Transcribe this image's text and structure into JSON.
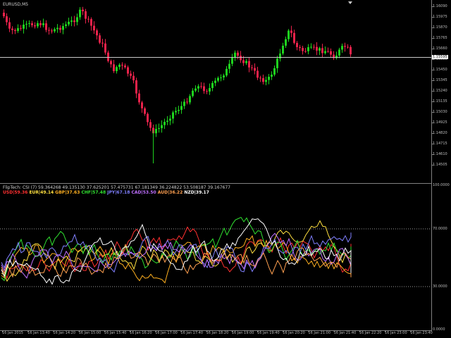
{
  "main_chart": {
    "title": "EURUSD,M5",
    "current_price": "1.15595",
    "price_labels": [
      "1.16090",
      "1.15975",
      "1.15870",
      "1.15765",
      "1.15660",
      "1.15555",
      "1.15450",
      "1.15345",
      "1.15240",
      "1.15135",
      "1.15030",
      "1.14925",
      "1.14820",
      "1.14715",
      "1.14610",
      "1.14505"
    ],
    "colors": {
      "bull": "#1ed21e",
      "bear": "#e8224a",
      "price_line": "#c8c8c8",
      "grid": "#404040"
    }
  },
  "indicator": {
    "title": "FlipTech: CSI (7) 59.364268 49.135130 37.625201 57.475731 67.181349 36.224822 53.508187 39.167677",
    "currencies": [
      {
        "code": "USD",
        "value": "59.36",
        "color": "#ff3030"
      },
      {
        "code": "EUR",
        "value": "49.14",
        "color": "#ffe040"
      },
      {
        "code": "GBP",
        "value": "37.63",
        "color": "#ffb020"
      },
      {
        "code": "CHF",
        "value": "57.48",
        "color": "#30e030"
      },
      {
        "code": "JPY",
        "value": "67.18",
        "color": "#8080ff"
      },
      {
        "code": "CAD",
        "value": "53.50",
        "color": "#c070ff"
      },
      {
        "code": "AUD",
        "value": "36.22",
        "color": "#ffa050"
      },
      {
        "code": "NZD",
        "value": "39.17",
        "color": "#ffffff"
      }
    ],
    "level_labels": [
      "100.0000",
      "70.0000",
      "30.0000",
      "0.0000"
    ],
    "levels": [
      100,
      70,
      30,
      0
    ]
  },
  "time_labels": [
    "16 Jan 2015",
    "16 Jan 13:40",
    "16 Jan 14:20",
    "16 Jan 15:00",
    "16 Jan 15:40",
    "16 Jan 16:20",
    "16 Jan 17:00",
    "16 Jan 17:40",
    "16 Jan 18:20",
    "16 Jan 19:00",
    "16 Jan 19:40",
    "16 Jan 20:20",
    "16 Jan 21:00",
    "16 Jan 21:40",
    "16 Jan 22:20",
    "16 Jan 23:00",
    "16 Jan 23:40"
  ]
}
